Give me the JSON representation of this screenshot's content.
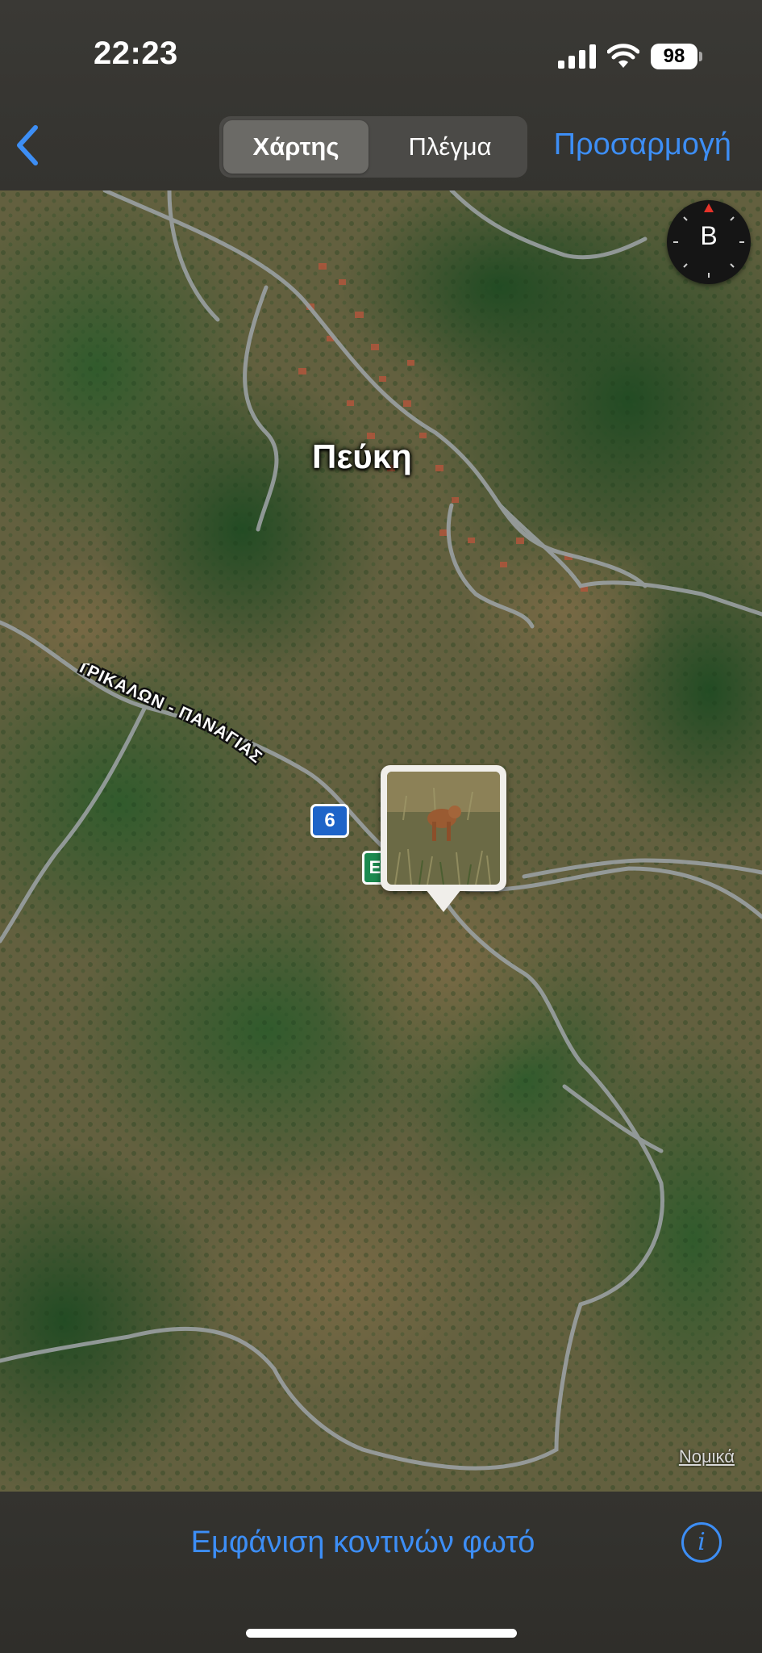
{
  "status_bar": {
    "time": "22:23",
    "battery": "98",
    "icons": [
      "cellular-signal-icon",
      "wifi-icon",
      "battery-icon"
    ]
  },
  "header": {
    "back_icon": "chevron-left-icon",
    "segments": [
      "Χάρτης",
      "Πλέγμα"
    ],
    "selected_segment": "Χάρτης",
    "customize_label": "Προσαρμογή"
  },
  "map": {
    "place_name": "Πεύκη",
    "road_name": "ΤΡΙΚΑΛΩΝ - ΠΑΝΑΓΙΑΣ",
    "route_shield": "6",
    "route_shield_e": "E",
    "compass_letter": "B",
    "legal_link": "Νομικά",
    "photo_pin": "photo-thumbnail-dog"
  },
  "footer": {
    "nearby_photos_label": "Εμφάνιση κοντινών φωτό",
    "info_icon": "info-icon"
  },
  "colors": {
    "accent": "#3d8ef5",
    "bar_background": "#34332f",
    "compass_north": "#e5332a"
  }
}
